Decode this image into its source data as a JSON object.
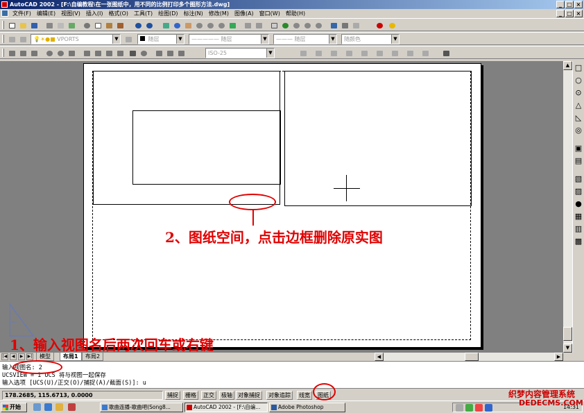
{
  "window": {
    "title": "AutoCAD 2002 - [F:\\自编教程\\在一张图纸中，用不同的比例打印多个图形方法.dwg]",
    "controls": [
      "_",
      "□",
      "×"
    ]
  },
  "menu": [
    "文件(F)",
    "编辑(E)",
    "视图(V)",
    "插入(I)",
    "格式(O)",
    "工具(T)",
    "绘图(D)",
    "标注(N)",
    "修改(M)",
    "图像(A)",
    "窗口(W)",
    "帮助(H)"
  ],
  "toolbar_layers": {
    "layer_value": "VPORTS",
    "color_value": "随层",
    "linetype_value": "随层",
    "lineweight_value": "随层",
    "plotstyle_value": "随颜色"
  },
  "toolbar_dims": {
    "dimstyle_value": "ISO-25"
  },
  "annotations": {
    "step1": "1、输入视图名后两次回车或右键",
    "step2": "2、图纸空间，点击边框删除原实图"
  },
  "layout_tabs": [
    "模型",
    "布局1",
    "布局2"
  ],
  "active_tab": "布局1",
  "command_lines": {
    "line1": "输入视图名: 2",
    "line2": "UCSVIEW = 1  UCS 将与视图一起保存",
    "line3": "输入选项 [UCS(U)/正交(O)/捕捉(A)/截面(S)]: u"
  },
  "status": {
    "coords": "178.2685, 115.6713, 0.0000",
    "toggles": [
      "捕捉",
      "栅格",
      "正交",
      "极轴",
      "对象捕捉",
      "对象追踪",
      "线宽",
      "图纸"
    ]
  },
  "taskbar": {
    "start": "开始",
    "tasks": [
      "歌曲连播-歌曲吧(Song8...",
      "AutoCAD 2002 - [F:\\自编...",
      "Adobe Photoshop"
    ],
    "clock": "14:31"
  },
  "watermark": {
    "line1": "织梦内容管理系统",
    "line2": "DEDECMS.COM"
  },
  "colors": {
    "annotation_red": "#e00000",
    "title_blue": "#0a246a",
    "model_space_bg": "#808080"
  }
}
